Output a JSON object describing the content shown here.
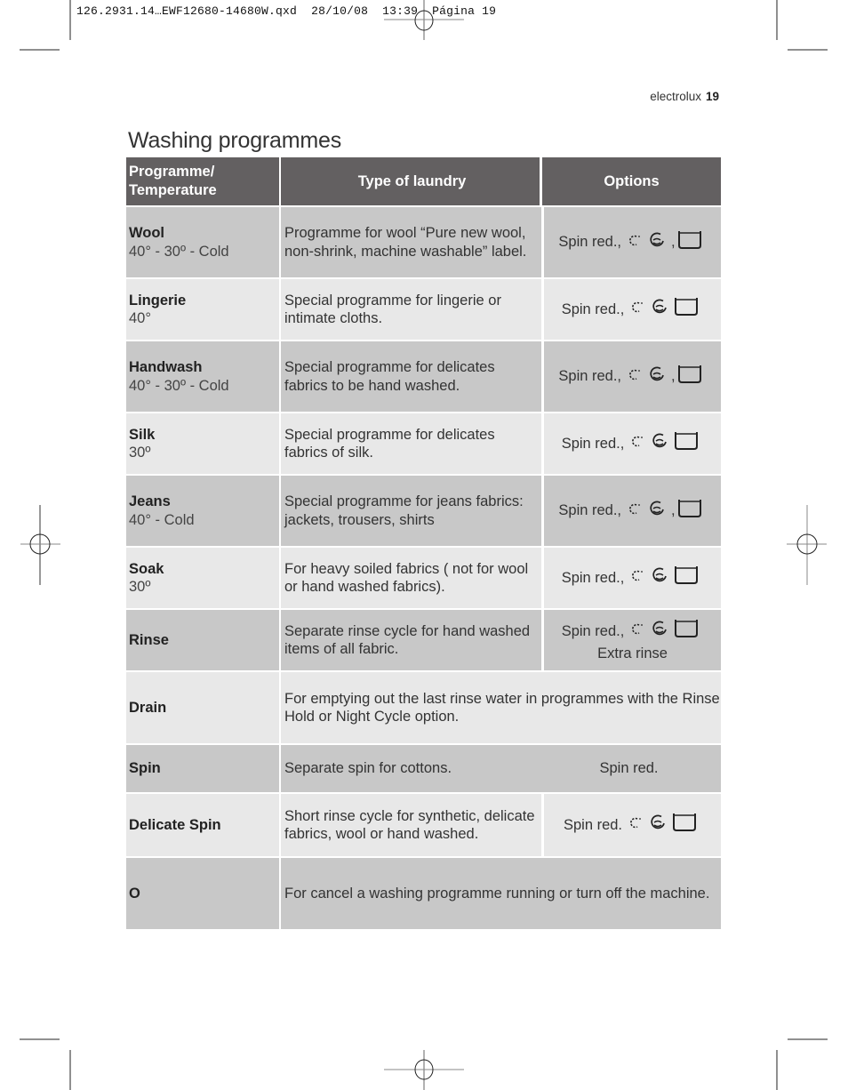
{
  "slug": {
    "filename": "126.2931.14…EWF12680-14680W.qxd",
    "date": "28/10/08",
    "time": "13:39",
    "page_label": "Página 19"
  },
  "running_head": {
    "brand": "electrolux",
    "page_number": "19"
  },
  "title": "Washing programmes",
  "table": {
    "headers": {
      "programme_line1": "Programme/",
      "programme_line2": "Temperature",
      "type": "Type of laundry",
      "options": "Options"
    },
    "rows": [
      {
        "name": "Wool",
        "temp": "40° - 30º - Cold",
        "type": "Programme for wool “Pure new wool, non-shrink, machine washable” label.",
        "options_text": "Spin red.,",
        "icons": [
          "night-cycle-icon",
          "rinse-hold-icon",
          "comma",
          "extra-rinse-tub-icon"
        ],
        "shade": "dark"
      },
      {
        "name": "Lingerie",
        "temp": "40°",
        "type": "Special programme for lingerie or intimate cloths.",
        "options_text": "Spin red.,",
        "icons": [
          "night-cycle-icon",
          "rinse-hold-icon",
          "extra-rinse-tub-icon"
        ],
        "shade": "light"
      },
      {
        "name": "Handwash",
        "temp": "40° - 30º - Cold",
        "type": "Special programme for delicates fabrics to be hand washed.",
        "options_text": "Spin red.,",
        "icons": [
          "night-cycle-icon",
          "rinse-hold-icon",
          "comma",
          "extra-rinse-tub-icon"
        ],
        "shade": "dark"
      },
      {
        "name": "Silk",
        "temp": "30º",
        "type": "Special programme for delicates fabrics of silk.",
        "options_text": "Spin red.,",
        "icons": [
          "night-cycle-icon",
          "rinse-hold-icon",
          "extra-rinse-tub-icon"
        ],
        "shade": "light"
      },
      {
        "name": "Jeans",
        "temp": "40° - Cold",
        "type": "Special programme for jeans fabrics: jackets, trousers, shirts",
        "options_text": "Spin red.,",
        "icons": [
          "night-cycle-icon",
          "rinse-hold-icon",
          "comma",
          "extra-rinse-tub-icon"
        ],
        "shade": "dark"
      },
      {
        "name": "Soak",
        "temp": "30º",
        "type": "For heavy soiled fabrics ( not for wool or hand washed fabrics).",
        "options_text": "Spin red.,",
        "icons": [
          "night-cycle-icon",
          "rinse-hold-icon",
          "extra-rinse-tub-icon"
        ],
        "shade": "light"
      },
      {
        "name": "Rinse",
        "temp": "",
        "type": "Separate rinse cycle for hand washed items of all fabric.",
        "options_text": "Spin red.,",
        "options_extra": "Extra rinse",
        "icons": [
          "night-cycle-icon",
          "rinse-hold-icon",
          "extra-rinse-tub-icon"
        ],
        "shade": "dark"
      },
      {
        "name": "Drain",
        "temp": "",
        "type": "For emptying out the last rinse water in programmes with the Rinse Hold or Night Cycle option.",
        "shade": "light",
        "wide": true
      },
      {
        "name": "Spin",
        "temp": "",
        "type": "Separate spin for cottons.",
        "options_text": "Spin red.",
        "icons": [],
        "shade": "dark",
        "noborder": true
      },
      {
        "name": "Delicate Spin",
        "temp": "",
        "type": "Short rinse cycle for synthetic, delicate fabrics, wool or hand washed.",
        "options_text": "Spin red.",
        "icons": [
          "night-cycle-icon",
          "rinse-hold-icon",
          "extra-rinse-tub-icon"
        ],
        "shade": "light"
      },
      {
        "name": "O",
        "temp": "",
        "type": "For cancel a washing programme running or turn off the machine.",
        "shade": "dark",
        "wide": true
      }
    ]
  }
}
